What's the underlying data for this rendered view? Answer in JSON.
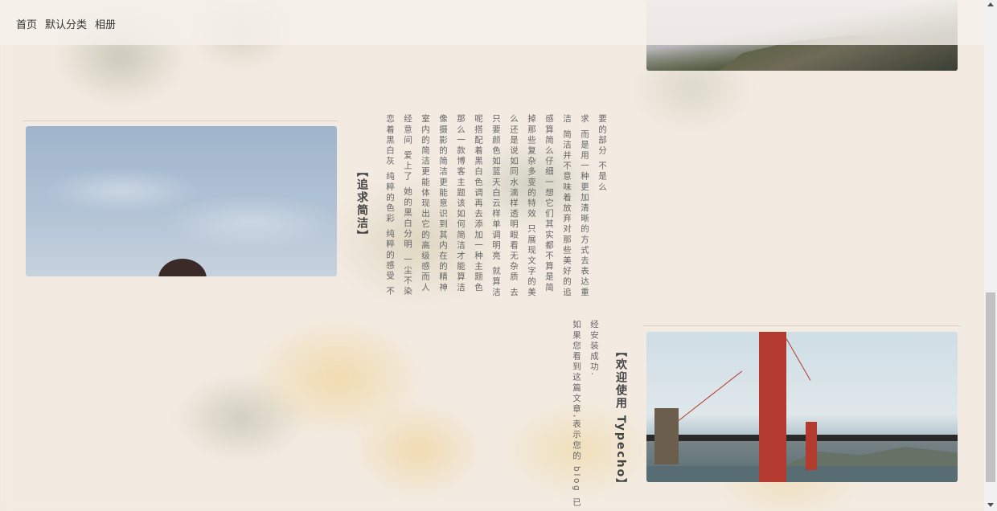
{
  "nav": {
    "items": [
      "首页",
      "默认分类",
      "相册"
    ]
  },
  "posts": [
    {
      "title": "【追求简洁】",
      "body_columns": [
        "要的部分 不是么",
        "求 而是用一种更加清晰的方式去表达重",
        "洁 简洁并不意味着放弃对那些美好的追",
        "感算简么仔细一想它们其实都不算是简",
        "掉那些复杂多变的特效 只展现文字的美",
        "么还是说如同水滴样透明眼看无杂质 去",
        "只要颜色如蓝天白云样单调明亮 就算洁",
        "呢搭配着黑白色调再去添加一种主题色",
        "那么一款博客主题该如何简洁才能算洁",
        "像摄影的简洁更能意识到其内在的精神",
        "室内的简洁更能体现出它的高级感而人",
        "经意间 爱上了 她的黑白分明 一尘不染",
        "恋着黑白灰 纯粹的色彩 纯粹的感受 不"
      ]
    },
    {
      "title": "【欢迎使用 Typecho】",
      "body_columns": [
        "经安装成功.",
        "如果您看到这篇文章,表示您的 blog 已"
      ]
    }
  ],
  "images": {
    "top_photo": "mountain landscape photo",
    "sky_photo": "sky with girl photo",
    "bridge_photo": "golden gate bridge photo"
  },
  "colors": {
    "background": "#f3ebe2",
    "bridge_red": "#b33a2f"
  }
}
